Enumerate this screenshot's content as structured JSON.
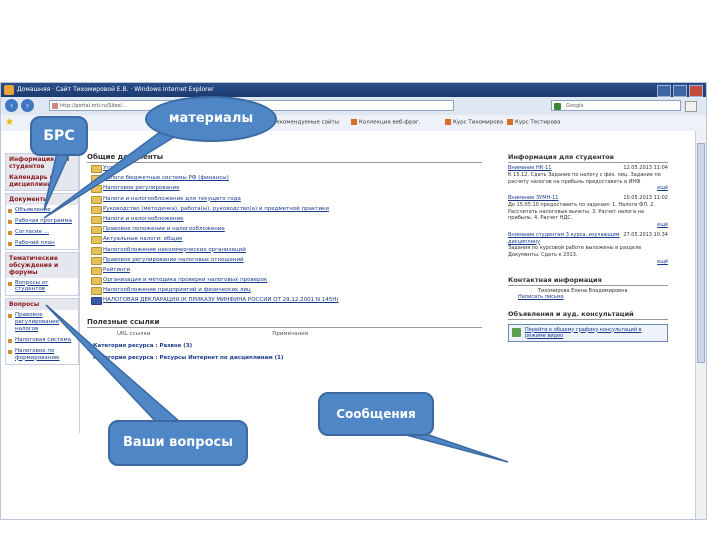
{
  "window": {
    "title": "Домашняя · Сайт Тихомировой Е.В. · Windows Internet Explorer",
    "address": "http://portal.mti.ru/Sites/...",
    "search_placeholder": "Google"
  },
  "favorites": [
    "Рекомендуемые сайты",
    "Коллекция веб-фраг.",
    "Курс Тихомирова",
    "Курс Тестирова"
  ],
  "left": {
    "block1_head": "Информация для студентов",
    "block2_head": "Календарь и дисциплины",
    "block3_head": "Документы",
    "docs": [
      "Объявление",
      "Рабочая программа",
      "Согласие ...",
      "Рабочий план"
    ],
    "block4_head": "Тематические обсуждения и форумы",
    "forum_item": "Вопросы от студентов",
    "block5_head": "Вопросы",
    "q_items": [
      "Правовое регулирование налогов",
      "Налоговая система",
      "Налоговое по формированию"
    ]
  },
  "main": {
    "docs_head": "Общие документы",
    "folders": [
      "Уго",
      "Налоги бюджетные системы РФ (финансы)",
      "Налоговое регулирование",
      "Налоги и налогообложение для текущего года",
      "Руководство (методичка), работа(ы), руководство(а) и предметной практики",
      "Налоги и налогообложение",
      "Правовое положение и налогообложение",
      "Актуальные налоги: общие",
      "Налогообложение некоммерческих организаций",
      "Правовое регулирование налоговых отношений",
      "Рейтинги",
      "Организация и методика проверки налоговых проверок",
      "Налогообложение предприятий и физических лиц",
      "НАЛОГОВАЯ ДЕКЛАРАЦИЯ (К ПРИКАЗУ МИНФИНА РОССИИ ОТ 29.12.2001 N 145Н)"
    ],
    "links_head": "Полезные ссылки",
    "links_row": [
      "URL ссылки",
      "Примечания"
    ],
    "cat1": "Категория ресурса : Развое (3)",
    "cat2": "Категория ресурса : Ресурсы Интернет по дисциплинам (1)"
  },
  "right": {
    "head": "Информация для студентов",
    "news": [
      {
        "title": "Внимание НК-11",
        "date": "12.05.2013 11:04",
        "body": "К 15.12. Сдать Задание по налогу с физ. лиц. Задание по расчету налогов на прибыль предоставить в ИНФ",
        "more": "ещё"
      },
      {
        "title": "Внимание ЗУМН-11",
        "date": "10.05.2013 11:02",
        "body": "До 15.05.10 предоставить по задачам: 1. Налоги ФЛ. 2. Рассчитать налоговые вычеты. 3. Расчет налога на прибыль. 4. Расчет НДС.",
        "more": "ещё"
      },
      {
        "title": "Внимание студентам 3 курса, изучающим дисциплину",
        "date": "27.05.2013 10:34",
        "body": "Задания по курсовой работе выложены в разделе Документы. Сдать к 2013.",
        "more": "ещё"
      }
    ],
    "contact_head": "Контактная информация",
    "contact_name": "Тихомирова Елена Владимировна",
    "contact_mail": "Написать письмо",
    "ann_head": "Объявления и ауд. консультаций",
    "ann_btn": "Перейти к общему графику консультаций в режиме видео"
  },
  "callouts": {
    "brs": "БРС",
    "materials": "материалы",
    "messages": "Сообщения",
    "questions": "Ваши вопросы"
  }
}
